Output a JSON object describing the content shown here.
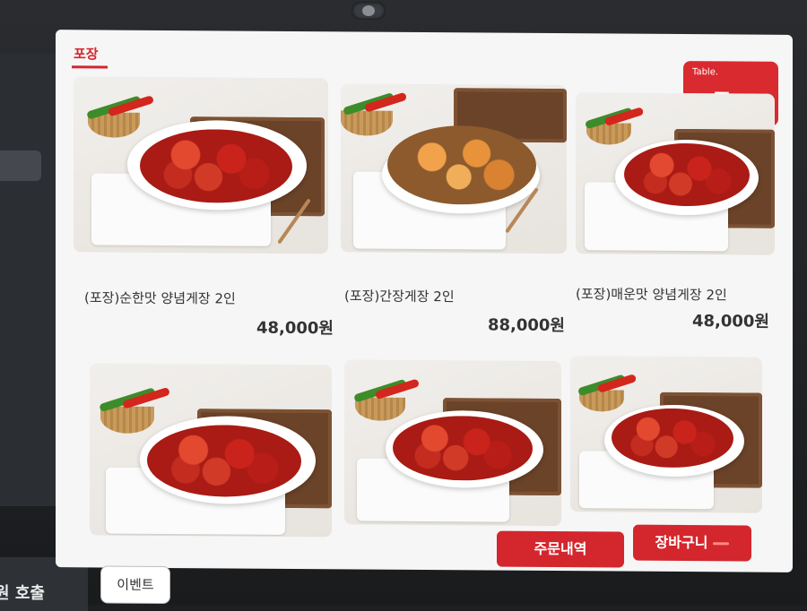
{
  "header": {
    "tab_label": "포장"
  },
  "table_badge": {
    "caption": "Table.",
    "room": "룸2"
  },
  "menu_items": [
    {
      "name": "(포장)순한맛 양념게장 2인",
      "price": "48,000원"
    },
    {
      "name": "(포장)간장게장 2인",
      "price": "88,000원"
    },
    {
      "name": "(포장)매운맛 양념게장 2인",
      "price": "48,000원"
    }
  ],
  "footer": {
    "order_history": "주문내역",
    "cart": "장바구니",
    "event": "이벤트",
    "staff_call": "원 호출"
  },
  "colors": {
    "accent": "#d4262d",
    "screen_bg": "#f6f6f6"
  }
}
